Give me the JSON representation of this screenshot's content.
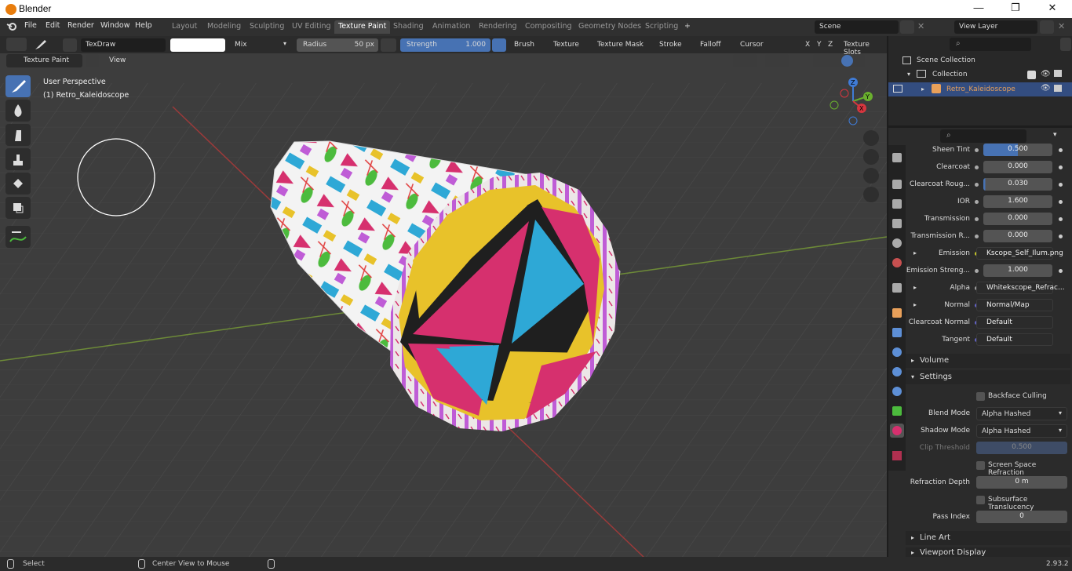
{
  "window": {
    "title": "Blender",
    "minimize": "—",
    "maximize": "❐",
    "close": "✕"
  },
  "menu": [
    "File",
    "Edit",
    "Render",
    "Window",
    "Help"
  ],
  "workspaces": [
    "Layout",
    "Modeling",
    "Sculpting",
    "UV Editing",
    "Texture Paint",
    "Shading",
    "Animation",
    "Rendering",
    "Compositing",
    "Geometry Nodes",
    "Scripting"
  ],
  "active_workspace": "Texture Paint",
  "add_workspace": "+",
  "scene": {
    "label": "Scene",
    "view_layer": "View Layer"
  },
  "tool_header": {
    "brush_name": "TexDraw",
    "blend": "Mix",
    "radius_label": "Radius",
    "radius_value": "50 px",
    "strength_label": "Strength",
    "strength_value": "1.000",
    "menus": [
      "Brush",
      "Texture",
      "Texture Mask",
      "Stroke",
      "Falloff",
      "Cursor"
    ],
    "axes": [
      "X",
      "Y",
      "Z"
    ],
    "texture_slots": "Texture Slots"
  },
  "mode": {
    "label": "Texture Paint",
    "view": "View"
  },
  "viewport": {
    "perspective": "User Perspective",
    "object": "(1) Retro_Kaleidoscope"
  },
  "gizmo": {
    "z": "Z",
    "y": "Y",
    "x": "X"
  },
  "outliner": {
    "scene_collection": "Scene Collection",
    "collection": "Collection",
    "object": "Retro_Kaleidoscope"
  },
  "properties": {
    "rows": [
      {
        "label": "Sheen Tint",
        "value": "0.500",
        "kind": "slider",
        "fill": 0.5
      },
      {
        "label": "Clearcoat",
        "value": "0.000",
        "kind": "slider",
        "fill": 0
      },
      {
        "label": "Clearcoat Roug...",
        "value": "0.030",
        "kind": "slider",
        "fill": 0.03
      },
      {
        "label": "IOR",
        "value": "1.600",
        "kind": "slider",
        "fill": 0
      },
      {
        "label": "Transmission",
        "value": "0.000",
        "kind": "slider",
        "fill": 0
      },
      {
        "label": "Transmission R...",
        "value": "0.000",
        "kind": "slider",
        "fill": 0
      },
      {
        "label": "Emission",
        "value": "Kscope_Self_Ilum.png",
        "kind": "link",
        "color": "#c7c729",
        "expand": true
      },
      {
        "label": "Emission Streng...",
        "value": "1.000",
        "kind": "slider",
        "fill": 0
      },
      {
        "label": "Alpha",
        "value": "Whitekscope_Refrac...",
        "kind": "link",
        "color": "#a1a1a1",
        "expand": true
      },
      {
        "label": "Normal",
        "value": "Normal/Map",
        "kind": "link",
        "color": "#6363c7",
        "expand": true
      },
      {
        "label": "Clearcoat Normal",
        "value": "Default",
        "kind": "link",
        "color": "#6363c7"
      },
      {
        "label": "Tangent",
        "value": "Default",
        "kind": "link",
        "color": "#6363c7"
      }
    ],
    "volume": "Volume",
    "settings": "Settings",
    "backface_culling": "Backface Culling",
    "blend_mode_label": "Blend Mode",
    "blend_mode": "Alpha Hashed",
    "shadow_mode_label": "Shadow Mode",
    "shadow_mode": "Alpha Hashed",
    "clip_threshold_label": "Clip Threshold",
    "clip_threshold": "0.500",
    "screen_space_refraction": "Screen Space Refraction",
    "refraction_depth_label": "Refraction Depth",
    "refraction_depth": "0 m",
    "subsurface_translucency": "Subsurface Translucency",
    "pass_index_label": "Pass Index",
    "pass_index": "0",
    "line_art": "Line Art",
    "viewport_display": "Viewport Display"
  },
  "status": {
    "select": "Select",
    "center": "Center View to Mouse",
    "version": "2.93.2"
  },
  "colors": {
    "accent": "#4772b3",
    "yellow": "#e8c22a",
    "magenta": "#d6306e",
    "cyan": "#2ea8d6",
    "object_orange": "#e8a05a"
  }
}
